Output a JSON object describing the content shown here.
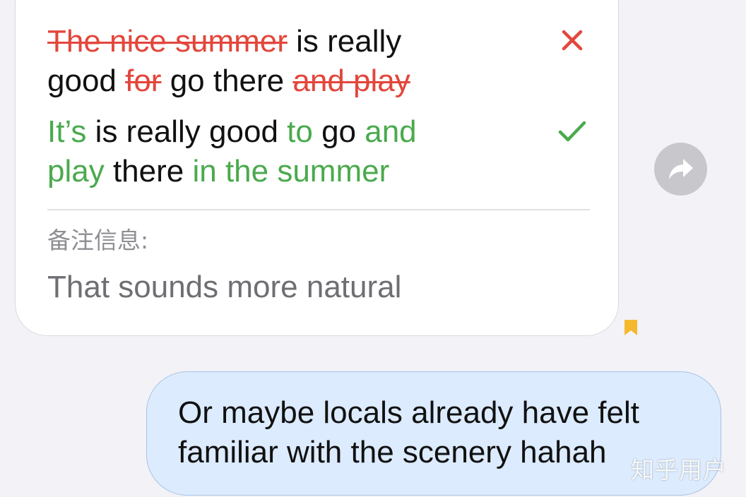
{
  "correction": {
    "line1": {
      "del1": "The nice summer",
      "text1": " is really"
    },
    "line2": {
      "text1": "good ",
      "del1": "for",
      "text2": " go there ",
      "del2": "and",
      "space": " ",
      "del3": "play"
    },
    "line3": {
      "ins1": "It’s",
      "text1": " is really good ",
      "ins2": "to",
      "text2": " go ",
      "ins3": "and"
    },
    "line4": {
      "ins1": "play",
      "text1": " there ",
      "ins2": "in the summer"
    },
    "wrong_icon": "close-icon",
    "right_icon": "checkmark-icon",
    "note_label": "备注信息:",
    "note_text": "That sounds more natural"
  },
  "share_icon": "share-arrow-icon",
  "bookmark_icon": "bookmark-icon",
  "message": {
    "line1": "Or maybe locals already have felt",
    "line2": "familiar with the scenery hahah"
  },
  "watermark": "知乎用户",
  "colors": {
    "deleted": "#e2473c",
    "inserted": "#4aaa4d",
    "bubble": "#dcebfe",
    "background": "#f2f2f7",
    "bookmark": "#f5b82e"
  }
}
